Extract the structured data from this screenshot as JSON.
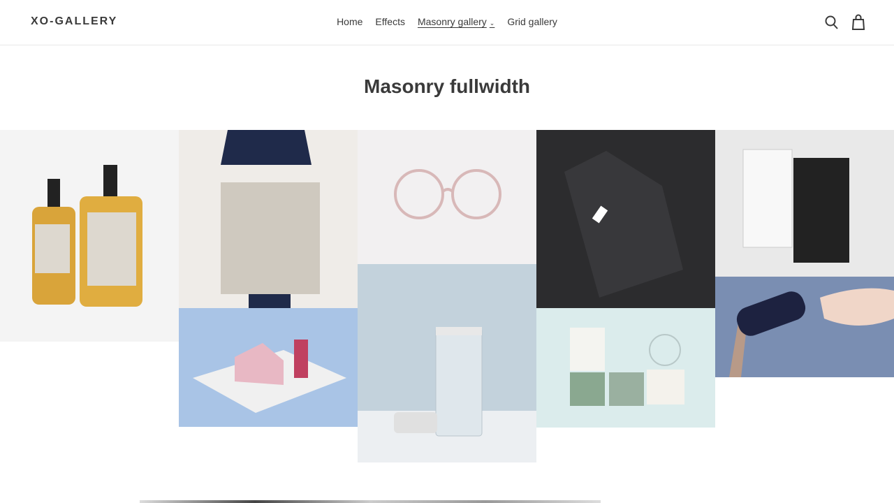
{
  "header": {
    "logo": "XO-GALLERY",
    "nav": [
      {
        "label": "Home"
      },
      {
        "label": "Effects"
      },
      {
        "label": "Masonry gallery",
        "active": true,
        "has_dropdown": true
      },
      {
        "label": "Grid gallery"
      }
    ],
    "icons": [
      "search-icon",
      "cart-icon"
    ]
  },
  "page": {
    "title": "Masonry fullwidth"
  },
  "gallery": {
    "items": [
      {
        "name": "soap-bottles",
        "bg": "#f4f4f4"
      },
      {
        "name": "tote-bag",
        "bg": "#efece8"
      },
      {
        "name": "paper-house",
        "bg": "#a9c4e6"
      },
      {
        "name": "round-glasses",
        "bg": "#f2f0f1"
      },
      {
        "name": "glass-jar",
        "bg": "#c3d2dc"
      },
      {
        "name": "dark-shirt",
        "bg": "#2c2c2e"
      },
      {
        "name": "stationery-set",
        "bg": "#dbecec"
      },
      {
        "name": "tshirt-packaging",
        "bg": "#e9e9e9"
      },
      {
        "name": "milk-bottle",
        "bg": "#7a8eb2"
      }
    ]
  }
}
